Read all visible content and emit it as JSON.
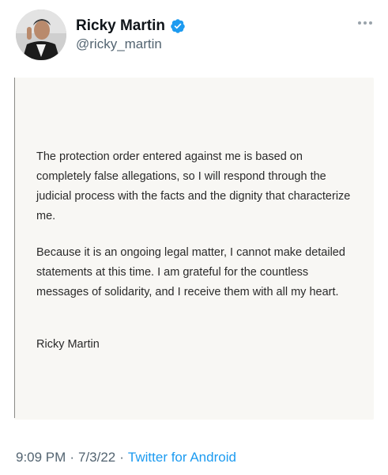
{
  "tweet": {
    "author": {
      "display_name": "Ricky Martin",
      "handle": "@ricky_martin",
      "verified": true
    },
    "statement": {
      "paragraphs": [
        "The protection order entered against me is based on completely false allegations, so I will respond through the judicial process with the facts and the dignity that characterize me.",
        "Because it is an ongoing legal matter, I cannot make detailed statements at this time. I am grateful for the countless messages of solidarity, and I receive them with all my heart."
      ],
      "signature": "Ricky Martin"
    },
    "meta": {
      "time": "9:09 PM",
      "date": "7/3/22",
      "separator": "·",
      "source": "Twitter for Android"
    }
  },
  "icons": {
    "verified": "verified-badge-icon",
    "more": "more-options-icon"
  },
  "colors": {
    "verified": "#1d9bf0",
    "link": "#1d9bf0",
    "secondary_text": "#536471",
    "card_background": "#f8f7f4"
  }
}
